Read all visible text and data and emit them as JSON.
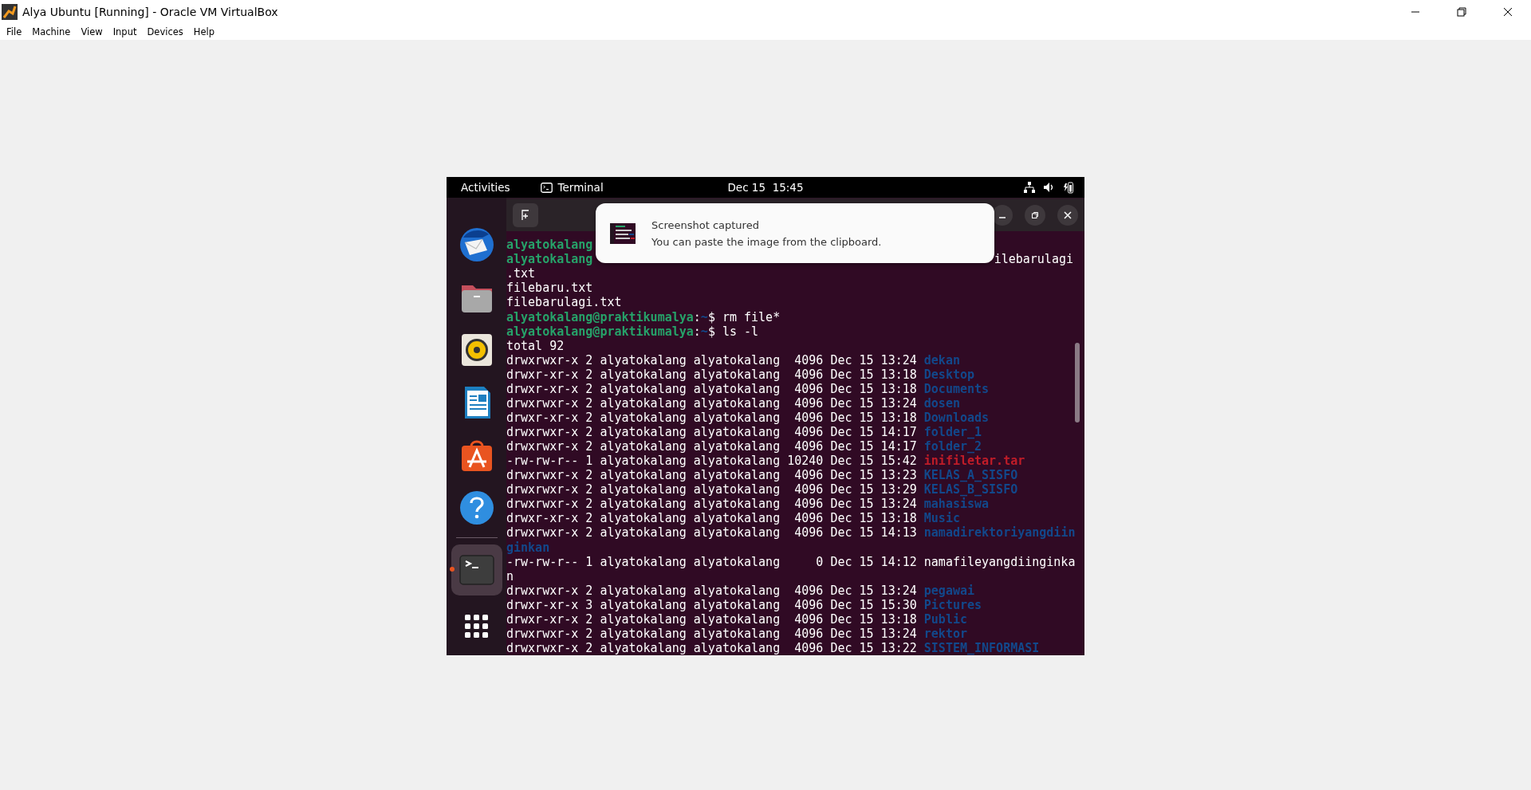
{
  "window": {
    "title": "Alya Ubuntu [Running] - Oracle VM VirtualBox"
  },
  "menu": [
    "File",
    "Machine",
    "View",
    "Input",
    "Devices",
    "Help"
  ],
  "top_bar": {
    "activities": "Activities",
    "app": "Terminal",
    "clock": "Dec 15  15:45"
  },
  "dock": [
    {
      "kind": "mail",
      "running": false
    },
    {
      "kind": "files",
      "running": false
    },
    {
      "kind": "music",
      "running": false
    },
    {
      "kind": "writer",
      "running": false
    },
    {
      "kind": "store",
      "running": false
    },
    {
      "kind": "help",
      "running": false
    },
    {
      "kind": "separator"
    },
    {
      "kind": "terminal",
      "running": true
    },
    {
      "kind": "apps",
      "running": false
    }
  ],
  "notification": {
    "title": "Screenshot captured",
    "body": "You can paste the image from the clipboard."
  },
  "terminal": {
    "lines": [
      {
        "segments": [
          {
            "kind": "user",
            "text": "alyatokalang"
          }
        ]
      },
      {
        "segments": [
          {
            "kind": "user",
            "text": "alyatokalang"
          }
        ],
        "tail": [
          {
            "kind": "plain",
            "text": "ilebarulagi"
          }
        ]
      },
      {
        "segments": [
          {
            "kind": "plain",
            "text": ".txt"
          }
        ]
      },
      {
        "segments": [
          {
            "kind": "plain",
            "text": "filebaru.txt"
          }
        ]
      },
      {
        "segments": [
          {
            "kind": "plain",
            "text": "filebarulagi.txt"
          }
        ]
      },
      {
        "segments": [
          {
            "kind": "user",
            "text": "alyatokalang@praktikumalya"
          },
          {
            "kind": "plain",
            "text": ":"
          },
          {
            "kind": "path",
            "text": "~"
          },
          {
            "kind": "plain",
            "text": "$ rm file*"
          }
        ]
      },
      {
        "segments": [
          {
            "kind": "user",
            "text": "alyatokalang@praktikumalya"
          },
          {
            "kind": "plain",
            "text": ":"
          },
          {
            "kind": "path",
            "text": "~"
          },
          {
            "kind": "plain",
            "text": "$ ls -l"
          }
        ]
      },
      {
        "segments": [
          {
            "kind": "plain",
            "text": "total 92"
          }
        ]
      },
      {
        "segments": [
          {
            "kind": "plain",
            "text": "drwxrwxr-x 2 alyatokalang alyatokalang  4096 Dec 15 13:24 "
          },
          {
            "kind": "dir",
            "text": "dekan"
          }
        ]
      },
      {
        "segments": [
          {
            "kind": "plain",
            "text": "drwxr-xr-x 2 alyatokalang alyatokalang  4096 Dec 15 13:18 "
          },
          {
            "kind": "dir",
            "text": "Desktop"
          }
        ]
      },
      {
        "segments": [
          {
            "kind": "plain",
            "text": "drwxr-xr-x 2 alyatokalang alyatokalang  4096 Dec 15 13:18 "
          },
          {
            "kind": "dir",
            "text": "Documents"
          }
        ]
      },
      {
        "segments": [
          {
            "kind": "plain",
            "text": "drwxrwxr-x 2 alyatokalang alyatokalang  4096 Dec 15 13:24 "
          },
          {
            "kind": "dir",
            "text": "dosen"
          }
        ]
      },
      {
        "segments": [
          {
            "kind": "plain",
            "text": "drwxr-xr-x 2 alyatokalang alyatokalang  4096 Dec 15 13:18 "
          },
          {
            "kind": "dir",
            "text": "Downloads"
          }
        ]
      },
      {
        "segments": [
          {
            "kind": "plain",
            "text": "drwxrwxr-x 2 alyatokalang alyatokalang  4096 Dec 15 14:17 "
          },
          {
            "kind": "dir",
            "text": "folder_1"
          }
        ]
      },
      {
        "segments": [
          {
            "kind": "plain",
            "text": "drwxrwxr-x 2 alyatokalang alyatokalang  4096 Dec 15 14:17 "
          },
          {
            "kind": "dir",
            "text": "folder_2"
          }
        ]
      },
      {
        "segments": [
          {
            "kind": "plain",
            "text": "-rw-rw-r-- 1 alyatokalang alyatokalang 10240 Dec 15 15:42 "
          },
          {
            "kind": "archive",
            "text": "inifiletar.tar"
          }
        ]
      },
      {
        "segments": [
          {
            "kind": "plain",
            "text": "drwxrwxr-x 2 alyatokalang alyatokalang  4096 Dec 15 13:23 "
          },
          {
            "kind": "dir",
            "text": "KELAS_A_SISFO"
          }
        ]
      },
      {
        "segments": [
          {
            "kind": "plain",
            "text": "drwxrwxr-x 2 alyatokalang alyatokalang  4096 Dec 15 13:29 "
          },
          {
            "kind": "dir",
            "text": "KELAS_B_SISFO"
          }
        ]
      },
      {
        "segments": [
          {
            "kind": "plain",
            "text": "drwxrwxr-x 2 alyatokalang alyatokalang  4096 Dec 15 13:24 "
          },
          {
            "kind": "dir",
            "text": "mahasiswa"
          }
        ]
      },
      {
        "segments": [
          {
            "kind": "plain",
            "text": "drwxr-xr-x 2 alyatokalang alyatokalang  4096 Dec 15 13:18 "
          },
          {
            "kind": "dir",
            "text": "Music"
          }
        ]
      },
      {
        "segments": [
          {
            "kind": "plain",
            "text": "drwxrwxr-x 2 alyatokalang alyatokalang  4096 Dec 15 14:13 "
          },
          {
            "kind": "dir",
            "text": "namadirektoriyangdiin"
          }
        ]
      },
      {
        "segments": [
          {
            "kind": "dir",
            "text": "ginkan"
          }
        ]
      },
      {
        "segments": [
          {
            "kind": "plain",
            "text": "-rw-rw-r-- 1 alyatokalang alyatokalang     0 Dec 15 14:12 namafileyangdiinginka"
          }
        ]
      },
      {
        "segments": [
          {
            "kind": "plain",
            "text": "n"
          }
        ]
      },
      {
        "segments": [
          {
            "kind": "plain",
            "text": "drwxrwxr-x 2 alyatokalang alyatokalang  4096 Dec 15 13:24 "
          },
          {
            "kind": "dir",
            "text": "pegawai"
          }
        ]
      },
      {
        "segments": [
          {
            "kind": "plain",
            "text": "drwxr-xr-x 3 alyatokalang alyatokalang  4096 Dec 15 15:30 "
          },
          {
            "kind": "dir",
            "text": "Pictures"
          }
        ]
      },
      {
        "segments": [
          {
            "kind": "plain",
            "text": "drwxr-xr-x 2 alyatokalang alyatokalang  4096 Dec 15 13:18 "
          },
          {
            "kind": "dir",
            "text": "Public"
          }
        ]
      },
      {
        "segments": [
          {
            "kind": "plain",
            "text": "drwxrwxr-x 2 alyatokalang alyatokalang  4096 Dec 15 13:24 "
          },
          {
            "kind": "dir",
            "text": "rektor"
          }
        ]
      },
      {
        "segments": [
          {
            "kind": "plain",
            "text": "drwxrwxr-x 2 alyatokalang alyatokalang  4096 Dec 15 13:22 "
          },
          {
            "kind": "dir",
            "text": "SISTEM_INFORMASI"
          }
        ]
      }
    ]
  }
}
